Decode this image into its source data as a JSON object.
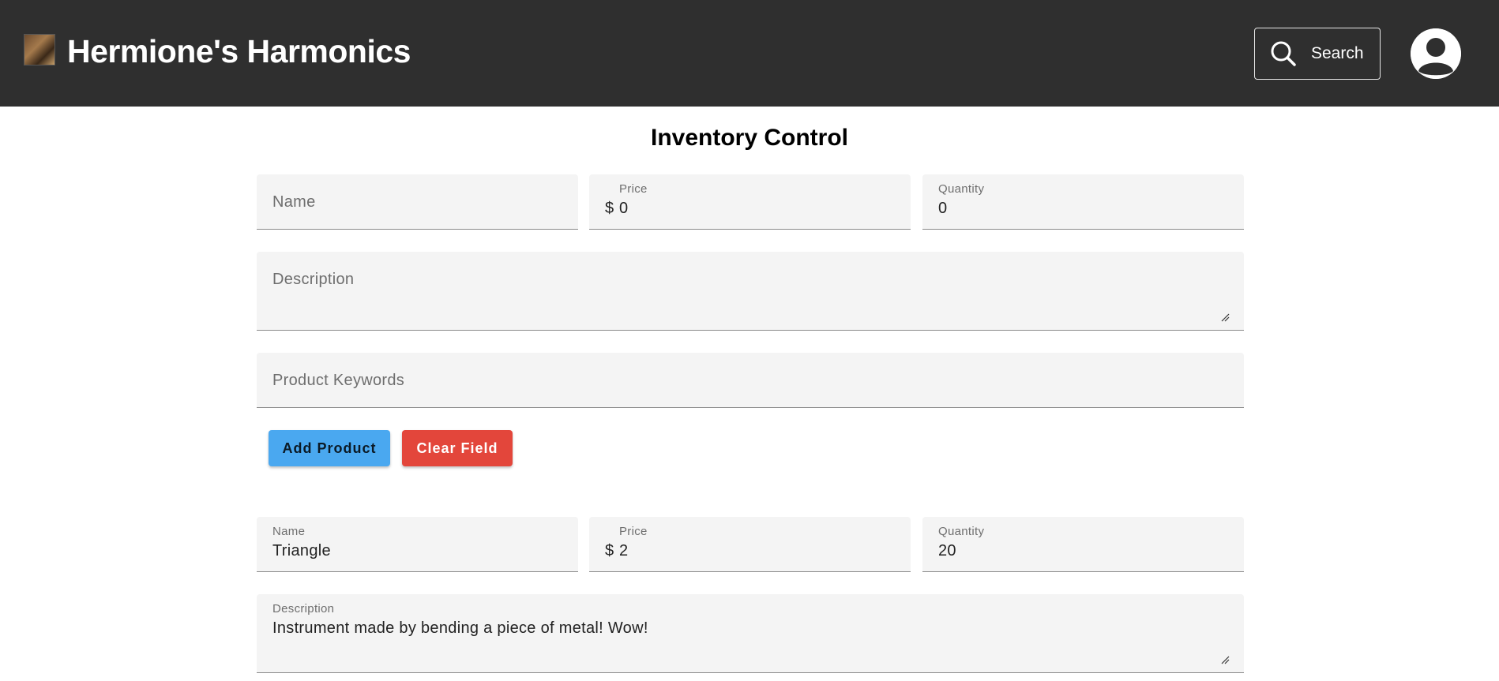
{
  "header": {
    "brand": "Hermione's Harmonics",
    "search_label": "Search"
  },
  "page": {
    "title": "Inventory Control"
  },
  "new_product": {
    "name_label": "Name",
    "price_label": "Price",
    "price_prefix": "$",
    "price_value": "0",
    "quantity_label": "Quantity",
    "quantity_value": "0",
    "description_label": "Description",
    "keywords_label": "Product Keywords",
    "add_label": "Add Product",
    "clear_label": "Clear Field"
  },
  "existing_product": {
    "name_label": "Name",
    "name_value": "Triangle",
    "price_label": "Price",
    "price_prefix": "$",
    "price_value": "2",
    "quantity_label": "Quantity",
    "quantity_value": "20",
    "description_label": "Description",
    "description_value": "Instrument made by bending a piece of metal! Wow!"
  },
  "colors": {
    "header_bg": "#2f2f2f",
    "add_button": "#4aa8f0",
    "clear_button": "#e3463b",
    "field_bg": "#f4f4f4"
  },
  "icons": [
    "logo-image",
    "search-icon",
    "account-icon",
    "resize-handle-icon"
  ]
}
